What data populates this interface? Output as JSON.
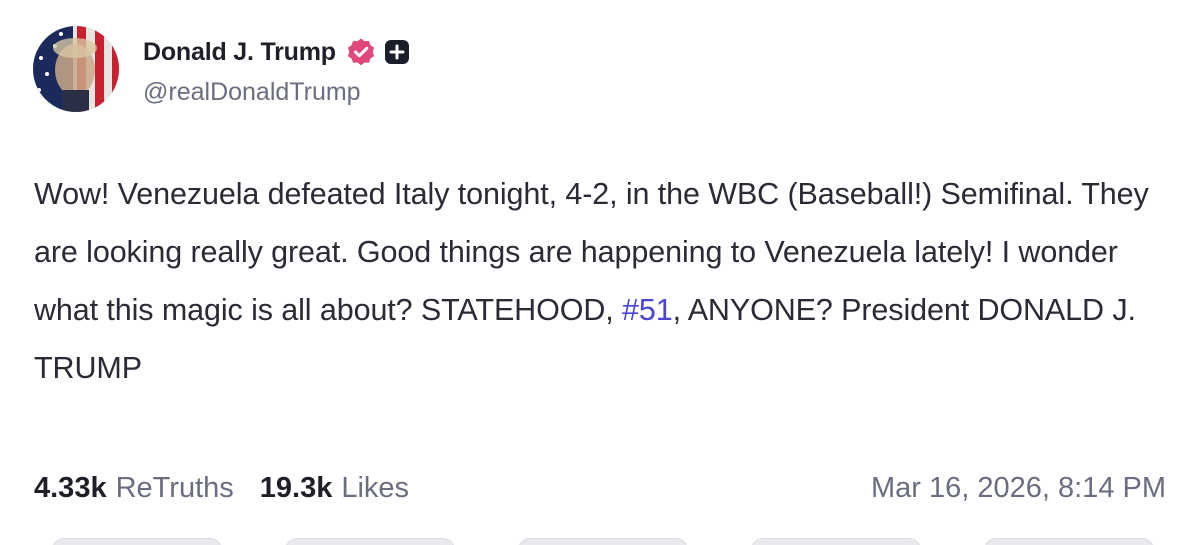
{
  "author": {
    "display_name": "Donald J. Trump",
    "handle": "@realDonaldTrump",
    "verified_icon": "verified-badge-icon",
    "verified_color": "#e0487a",
    "plus_icon": "plus-badge-icon"
  },
  "post": {
    "text_before_hashtag": "Wow! Venezuela defeated Italy tonight, 4-2, in the WBC (Baseball!) Semifinal. They are looking really great. Good things are happening to Venezuela lately! I wonder what this magic is all about? STATEHOOD, ",
    "hashtag": "#51",
    "text_after_hashtag": ", ANYONE? President DONALD J. TRUMP",
    "hashtag_color": "#4b44d8"
  },
  "stats": {
    "retruths_count": "4.33k",
    "retruths_label": "ReTruths",
    "likes_count": "19.3k",
    "likes_label": "Likes"
  },
  "timestamp": "Mar 16, 2026, 8:14 PM",
  "action_buttons": [
    "reply-button",
    "retruth-button",
    "like-button",
    "share-button",
    "more-button"
  ]
}
